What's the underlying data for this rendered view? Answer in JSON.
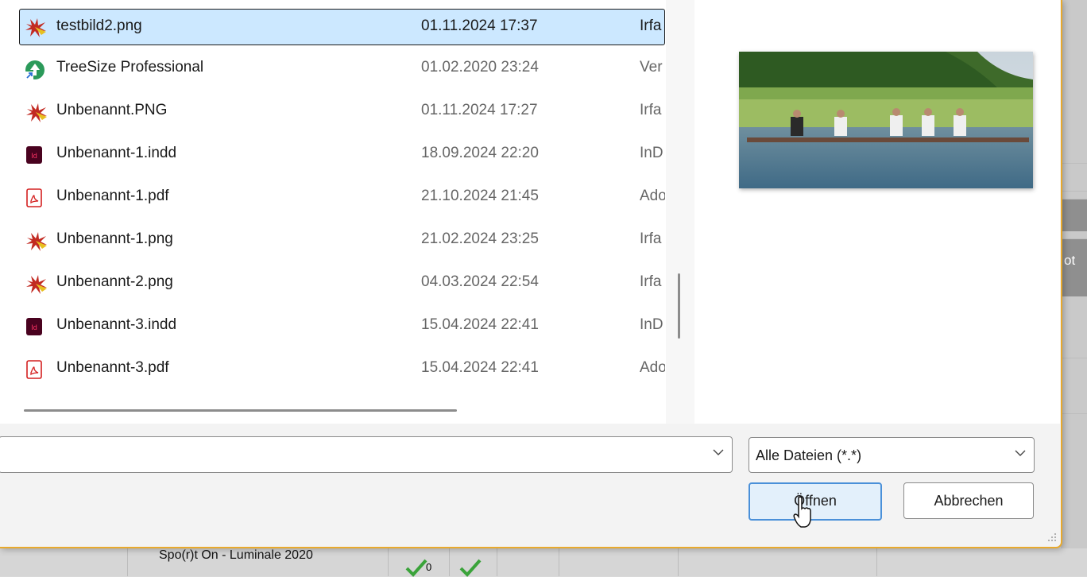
{
  "files": [
    {
      "name": "testbild2.png",
      "date": "01.11.2024 17:37",
      "type": "Irfa",
      "icon": "irfanview-icon",
      "selected": true
    },
    {
      "name": "TreeSize Professional",
      "date": "01.02.2020 23:24",
      "type": "Ver",
      "icon": "treesize-shortcut-icon"
    },
    {
      "name": "Unbenannt.PNG",
      "date": "01.11.2024 17:27",
      "type": "Irfa",
      "icon": "irfanview-icon"
    },
    {
      "name": "Unbenannt-1.indd",
      "date": "18.09.2024 22:20",
      "type": "InD",
      "icon": "indesign-icon"
    },
    {
      "name": "Unbenannt-1.pdf",
      "date": "21.10.2024 21:45",
      "type": "Ado",
      "icon": "pdf-icon"
    },
    {
      "name": "Unbenannt-1.png",
      "date": "21.02.2024 23:25",
      "type": "Irfa",
      "icon": "irfanview-icon"
    },
    {
      "name": "Unbenannt-2.png",
      "date": "04.03.2024 22:54",
      "type": "Irfa",
      "icon": "irfanview-icon"
    },
    {
      "name": "Unbenannt-3.indd",
      "date": "15.04.2024 22:41",
      "type": "InD",
      "icon": "indesign-icon"
    },
    {
      "name": "Unbenannt-3.pdf",
      "date": "15.04.2024 22:41",
      "type": "Ado",
      "icon": "pdf-icon"
    }
  ],
  "filename": {
    "value": ""
  },
  "filter": {
    "value": "Alle Dateien (*.*)"
  },
  "buttons": {
    "open": "Öffnen",
    "cancel": "Abbrechen"
  },
  "background": {
    "ot_text": "ot",
    "luminale_text": "Spo(r)t On - Luminale 2020",
    "check_count": "0"
  },
  "colors": {
    "selection": "#cce8ff",
    "accent_border": "#e8a92c",
    "primary_border": "#4a90d9"
  }
}
